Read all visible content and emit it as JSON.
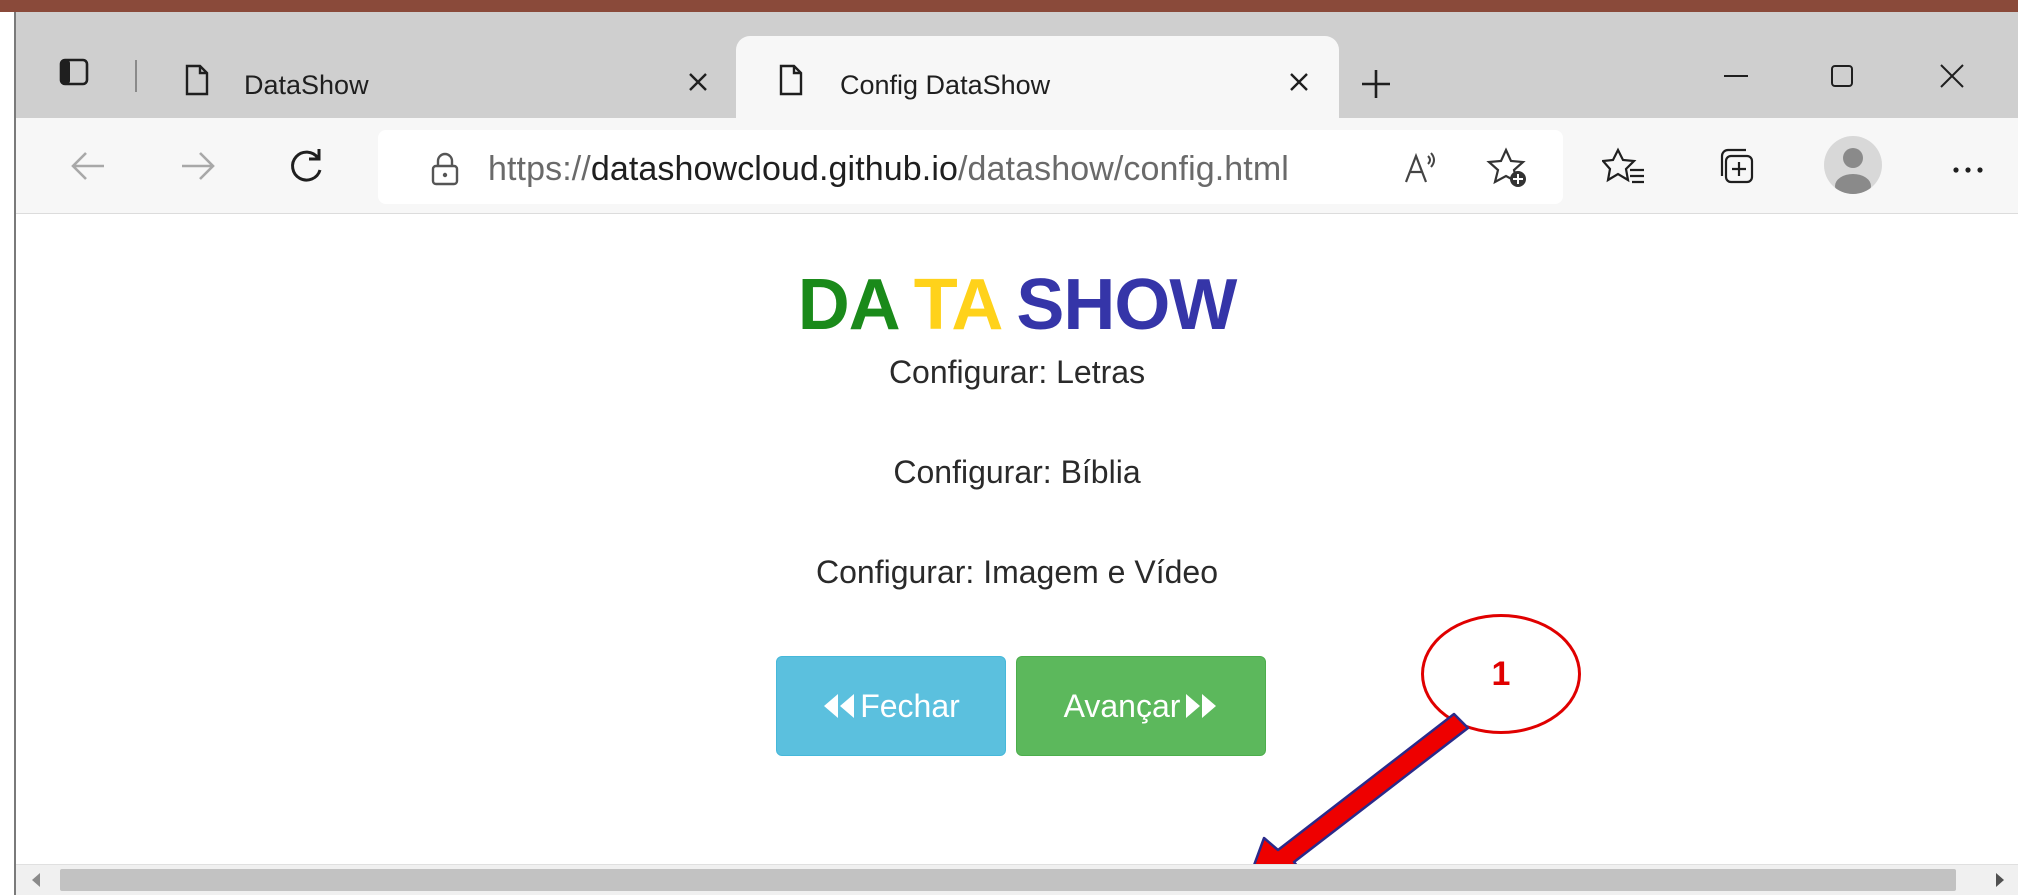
{
  "browser": {
    "tabs": [
      {
        "title": "DataShow",
        "active": false
      },
      {
        "title": "Config DataShow",
        "active": true
      }
    ],
    "address": {
      "scheme": "https://",
      "host": "datashowcloud.github.io",
      "path": "/datashow/config.html"
    }
  },
  "page": {
    "logo": {
      "part1": "DA",
      "part2": "TA",
      "part3": "SHOW"
    },
    "options": [
      "Configurar: Letras",
      "Configurar: Bíblia",
      "Configurar: Imagem e Vídeo"
    ],
    "buttons": {
      "close_label": "Fechar",
      "next_label": "Avançar"
    }
  },
  "annotation": {
    "number": "1"
  },
  "colors": {
    "logo_da": "#1a8a1a",
    "logo_ta": "#ffd21a",
    "logo_show": "#3535a8",
    "btn_info": "#5bc0de",
    "btn_success": "#5cb85c",
    "annotation": "#e00000"
  }
}
